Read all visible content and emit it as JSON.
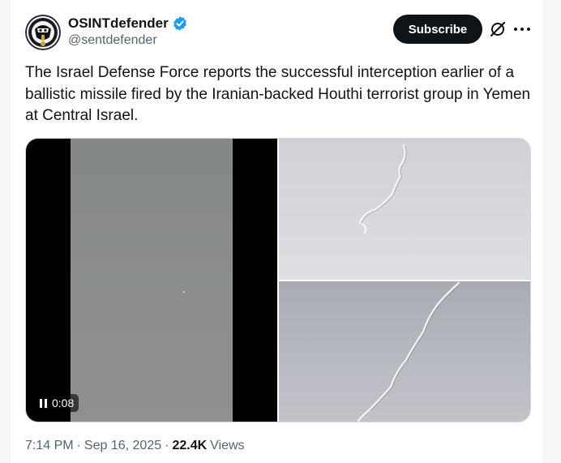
{
  "post": {
    "author": {
      "display_name": "OSINTdefender",
      "handle": "@sentdefender",
      "verified": true,
      "avatar": "osintdefender-logo"
    },
    "subscribe_label": "Subscribe",
    "text": "The Israel Defense Force reports the successful interception earlier of a ballistic missile fired by the Iranian-backed Houthi terrorist group in Yemen at Central Israel.",
    "media": {
      "video": {
        "time": "0:08",
        "state": "playing",
        "control_icon": "pause-icon"
      },
      "photos": [
        "missile-trail-photo-top",
        "missile-trail-photo-bottom"
      ]
    },
    "footer": {
      "time": "7:14 PM",
      "date": "Sep 16, 2025",
      "separator": "·",
      "views_count": "22.4K",
      "views_label": "Views"
    }
  },
  "icons": {
    "verified": "verified-badge-icon",
    "grok": "grok-icon",
    "more": "more-options-icon"
  },
  "colors": {
    "text_primary": "#0f1419",
    "text_secondary": "#536471",
    "verified_blue": "#1d9bf0",
    "button_bg": "#0f1419",
    "border": "#cfd9de"
  }
}
